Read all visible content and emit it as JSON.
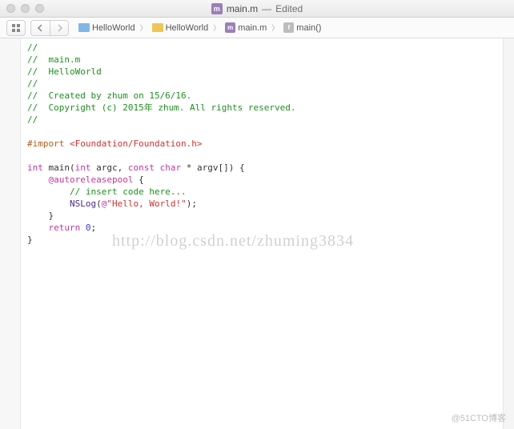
{
  "window": {
    "filename": "main.m",
    "state": "Edited"
  },
  "breadcrumb": {
    "items": [
      {
        "label": "HelloWorld",
        "icon": "project"
      },
      {
        "label": "HelloWorld",
        "icon": "folder"
      },
      {
        "label": "main.m",
        "icon": "m-file"
      },
      {
        "label": "main()",
        "icon": "func"
      }
    ]
  },
  "code": {
    "c1": "//",
    "c2": "//  main.m",
    "c3": "//  HelloWorld",
    "c4": "//",
    "c5": "//  Created by zhum on 15/6/16.",
    "c6": "//  Copyright (c) 2015年 zhum. All rights reserved.",
    "c7": "//",
    "import_dir": "#import",
    "import_path": " <Foundation/Foundation.h>",
    "sig_ty1": "int",
    "sig_name": " main(",
    "sig_ty2": "int",
    "sig_p1": " argc, ",
    "sig_ty3": "const",
    "sig_ty4": " char",
    "sig_p2": " * argv[]) {",
    "auto": "@autoreleasepool",
    "auto_brace": " {",
    "insert": "// insert code here...",
    "nslog": "NSLog",
    "nslog_open": "(",
    "nslog_at": "@",
    "nslog_str": "\"Hello, World!\"",
    "nslog_close": ");",
    "close1": "}",
    "ret_kw": "return",
    "ret_val": " 0",
    "ret_semi": ";",
    "close2": "}"
  },
  "watermark": "http://blog.csdn.net/zhuming3834",
  "corner": "@51CTO博客"
}
